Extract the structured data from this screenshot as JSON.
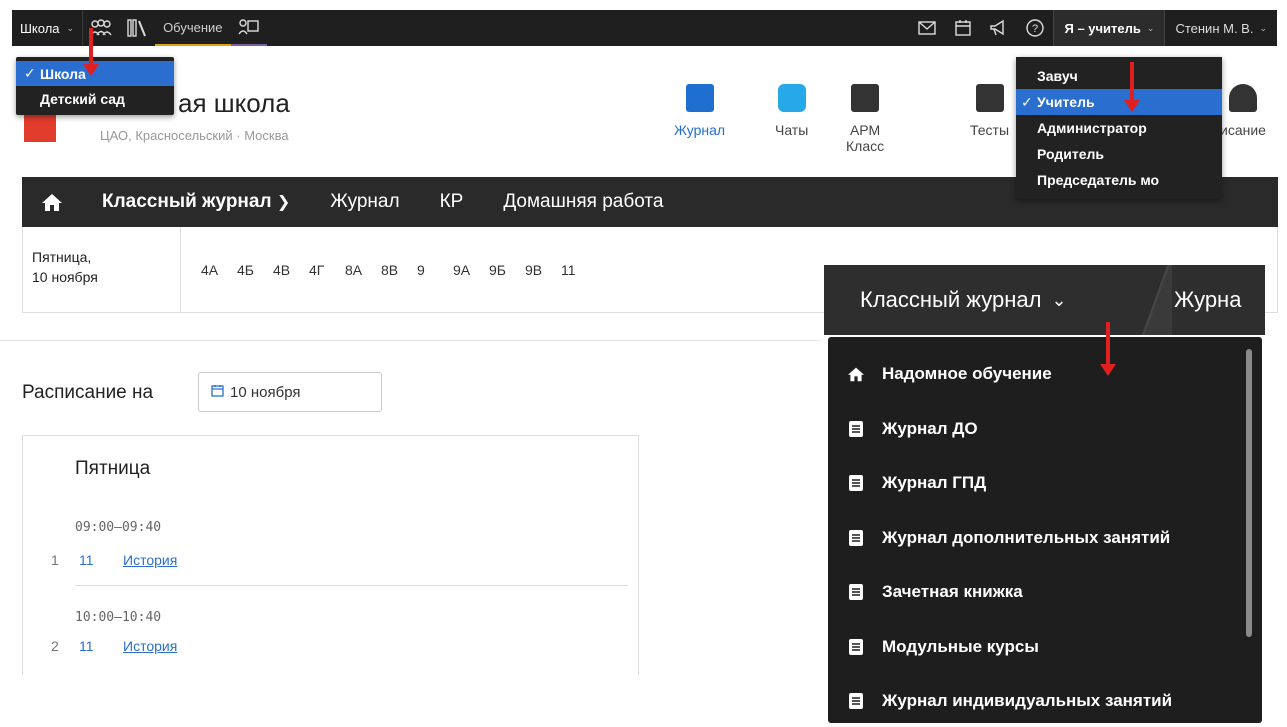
{
  "topbar": {
    "school_label": "Школа",
    "learning_label": "Обучение",
    "role_label": "Я – учитель",
    "user_label": "Стенин М. В."
  },
  "school_menu": {
    "items": [
      {
        "label": "Школа",
        "checked": true
      },
      {
        "label": "Детский сад",
        "checked": false
      }
    ]
  },
  "role_menu": {
    "items": [
      {
        "label": "Завуч",
        "checked": false
      },
      {
        "label": "Учитель",
        "checked": true
      },
      {
        "label": "Администратор",
        "checked": false
      },
      {
        "label": "Родитель",
        "checked": false
      },
      {
        "label": "Председатель мо",
        "checked": false
      }
    ]
  },
  "school": {
    "title": "ая школа",
    "address": "ЦАО, Красносельский · Москва"
  },
  "apps": [
    {
      "label": "Журнал",
      "color": "#1f6fd0"
    },
    {
      "label": "Чаты",
      "color": "#27a8e8"
    },
    {
      "label": "АРМ Класс",
      "color": "#333333"
    },
    {
      "label": "Тесты",
      "color": "#333333"
    },
    {
      "label": "исание",
      "color": "#333333"
    }
  ],
  "nav": {
    "class_journal": "Классный журнал",
    "journal": "Журнал",
    "kr": "КР",
    "homework": "Домашняя работа"
  },
  "class_row": {
    "date_line1": "Пятница,",
    "date_line2": "10 ноября",
    "classes": [
      "4А",
      "4Б",
      "4В",
      "4Г",
      "8А",
      "8В",
      "9",
      "9А",
      "9Б",
      "9В",
      "11"
    ]
  },
  "schedule": {
    "title": "Расписание на",
    "date": "10 ноября",
    "day": "Пятница",
    "lessons": [
      {
        "time": "09:00–09:40",
        "num": "1",
        "grade": "11",
        "subject": "История"
      },
      {
        "time": "10:00–10:40",
        "num": "2",
        "grade": "11",
        "subject": "История"
      }
    ]
  },
  "journal_panel": {
    "header": "Классный журнал",
    "next": "Журна",
    "items": [
      {
        "label": "Надомное обучение",
        "icon": "home-icon"
      },
      {
        "label": "Журнал ДО",
        "icon": "book-icon"
      },
      {
        "label": "Журнал ГПД",
        "icon": "book-icon"
      },
      {
        "label": "Журнал дополнительных занятий",
        "icon": "book-icon"
      },
      {
        "label": "Зачетная книжка",
        "icon": "book-icon"
      },
      {
        "label": "Модульные курсы",
        "icon": "book-icon"
      },
      {
        "label": "Журнал индивидуальных занятий",
        "icon": "book-icon"
      }
    ]
  },
  "colors": {
    "accent": "#2a6fd0",
    "dark": "#222222",
    "annotation_arrow": "#e02020"
  }
}
